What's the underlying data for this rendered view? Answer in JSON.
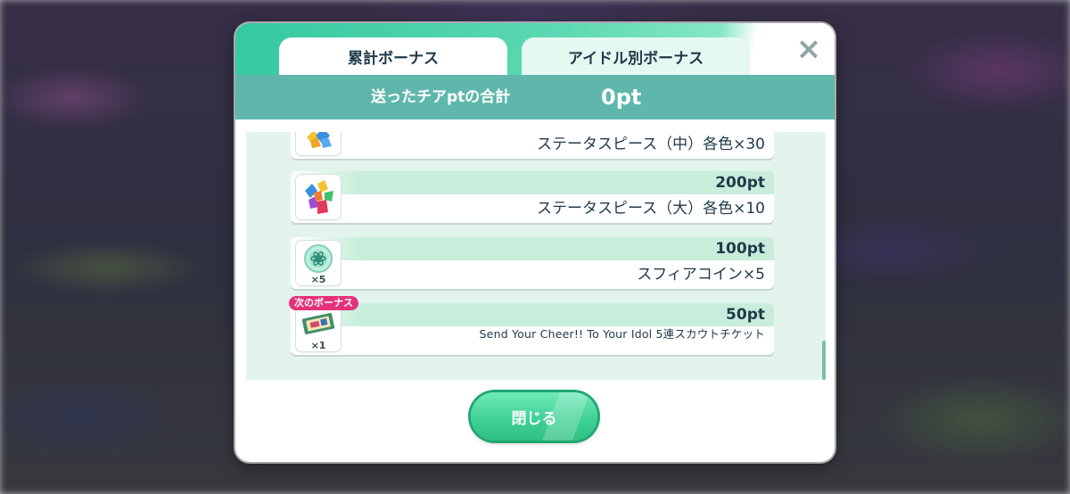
{
  "tabs": [
    {
      "label": "累計ボーナス",
      "active": true
    },
    {
      "label": "アイドル別ボーナス",
      "active": false
    }
  ],
  "close_icon": "×",
  "summary": {
    "label": "送ったチアptの合計",
    "value": "0pt"
  },
  "rewards": [
    {
      "points": "",
      "reward": "ステータスピース（中）各色×30",
      "icon": "gem-cluster-medium-icon",
      "qty": ""
    },
    {
      "points": "200pt",
      "reward": "ステータスピース（大）各色×10",
      "icon": "gem-cluster-large-icon",
      "qty": ""
    },
    {
      "points": "100pt",
      "reward": "スフィアコイン×5",
      "icon": "sphere-coin-icon",
      "qty": "×5"
    },
    {
      "points": "50pt",
      "reward": "Send Your Cheer!! To Your Idol 5連スカウトチケット",
      "icon": "scout-ticket-icon",
      "qty": "×1"
    }
  ],
  "next_bonus_badge": "次のボーナス",
  "close_button": "閉じる",
  "colors": {
    "header_gradient_start": "#35c9a0",
    "summary_bar": "#5fb7ac",
    "list_bg": "#e3f4ec",
    "points_band": "#c8eedb",
    "badge": "#e5317a",
    "button": "#3dcf94"
  }
}
